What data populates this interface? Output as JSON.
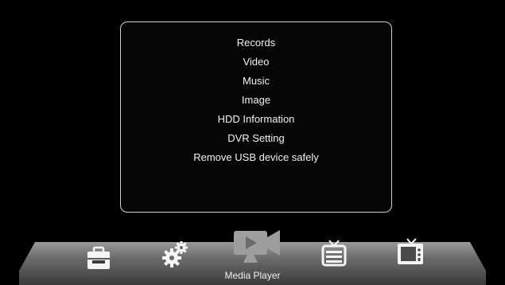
{
  "menu": {
    "items": [
      {
        "label": "Records"
      },
      {
        "label": "Video"
      },
      {
        "label": "Music"
      },
      {
        "label": "Image"
      },
      {
        "label": "HDD Information"
      },
      {
        "label": "DVR Setting"
      },
      {
        "label": "Remove USB device safely"
      }
    ]
  },
  "dock": {
    "icons": [
      {
        "icon": "toolbox-icon"
      },
      {
        "icon": "gears-icon"
      },
      {
        "icon": "media-player-icon",
        "selected": true
      },
      {
        "icon": "tv-guide-icon"
      },
      {
        "icon": "tv-icon"
      }
    ],
    "selected_label": "Media Player"
  }
}
